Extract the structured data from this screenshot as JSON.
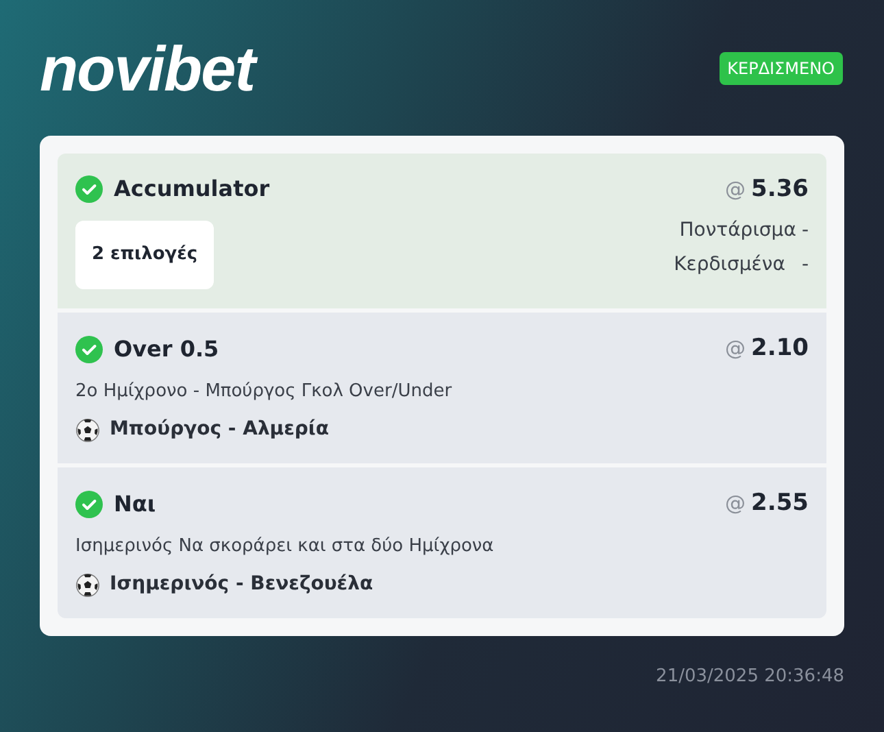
{
  "logo": "novibet",
  "status_badge": "ΚΕΡΔΙΣΜΕΝΟ",
  "bet": {
    "title": "Accumulator",
    "won": true,
    "odds_prefix": "@",
    "odds": "5.36",
    "selections_count": "2 επιλογές",
    "stake_label": "Ποντάρισμα",
    "stake": "-",
    "winnings_label": "Κερδισμένα",
    "winnings": "-"
  },
  "selections": [
    {
      "pick": "Over 0.5",
      "won": true,
      "odds_prefix": "@",
      "odds": "2.10",
      "market": "2ο Ημίχρονο - Μπούργος Γκολ Over/Under",
      "event": "Μπούργος - Αλμερία"
    },
    {
      "pick": "Ναι",
      "won": true,
      "odds_prefix": "@",
      "odds": "2.55",
      "market": "Ισημερινός Να σκοράρει και στα δύο Ημίχρονα",
      "event": "Ισημερινός - Βενεζουέλα"
    }
  ],
  "timestamp": "21/03/2025 20:36:48"
}
